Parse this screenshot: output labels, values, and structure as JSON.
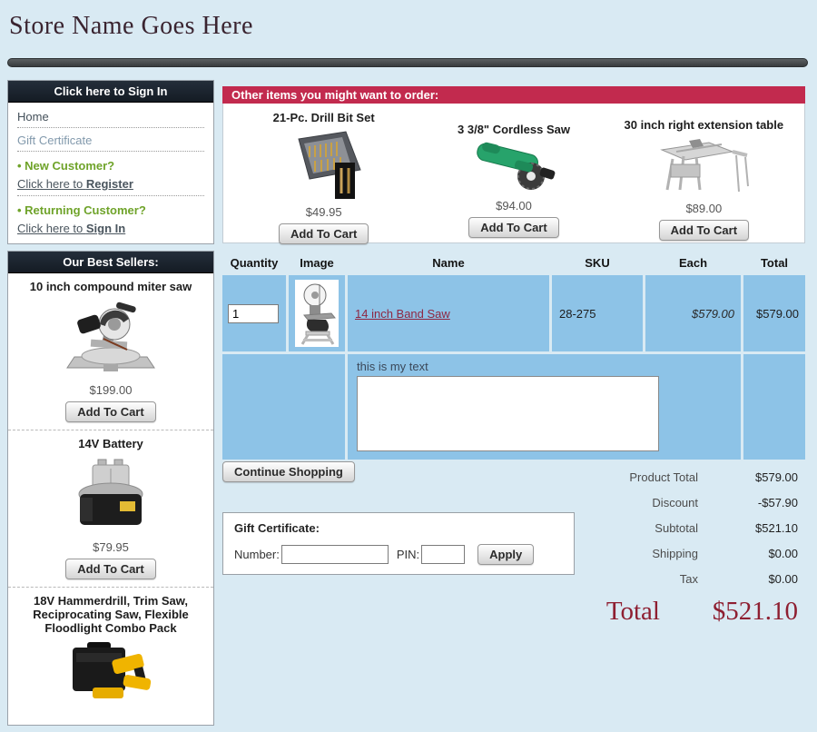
{
  "header": {
    "title": "Store Name Goes Here"
  },
  "sidebar": {
    "signin_box": {
      "header": "Click here to Sign In",
      "links": [
        {
          "label": "Home"
        },
        {
          "label": "Gift Certificate"
        }
      ],
      "new_customer": {
        "prompt": "• New Customer?",
        "link_prefix": "Click here to ",
        "link_bold": "Register"
      },
      "returning_customer": {
        "prompt": "• Returning Customer?",
        "link_prefix": "Click here to ",
        "link_bold": "Sign In"
      }
    },
    "best_sellers": {
      "header": "Our Best Sellers:",
      "products": [
        {
          "name": "10 inch compound miter saw",
          "price": "$199.00",
          "button": "Add To Cart",
          "image": "miter-saw"
        },
        {
          "name": "14V Battery",
          "price": "$79.95",
          "button": "Add To Cart",
          "image": "14v-battery"
        },
        {
          "name": "18V Hammerdrill, Trim Saw, Reciprocating Saw, Flexible Floodlight Combo Pack",
          "image": "combo-kit"
        }
      ]
    }
  },
  "upsell": {
    "header": "Other items you might want to order:",
    "products": [
      {
        "name": "21-Pc. Drill Bit Set",
        "price": "$49.95",
        "button": "Add To Cart",
        "image": "drill-bit-set"
      },
      {
        "name": "3 3/8\" Cordless Saw",
        "price": "$94.00",
        "button": "Add To Cart",
        "image": "cordless-saw"
      },
      {
        "name": "30 inch right extension table",
        "price": "$89.00",
        "button": "Add To Cart",
        "image": "extension-table"
      }
    ]
  },
  "cart": {
    "columns": {
      "quantity": "Quantity",
      "image": "Image",
      "name": "Name",
      "sku": "SKU",
      "each": "Each",
      "total": "Total"
    },
    "items": [
      {
        "quantity": "1",
        "name": "14 inch Band Saw",
        "sku": "28-275",
        "each": "$579.00",
        "total": "$579.00",
        "image": "band-saw"
      }
    ],
    "note_label": "this is my text",
    "note_value": ""
  },
  "actions": {
    "continue_shopping": "Continue Shopping"
  },
  "gift_certificate": {
    "title": "Gift Certificate:",
    "number_label": "Number:",
    "number_value": "",
    "pin_label": "PIN:",
    "pin_value": "",
    "apply_button": "Apply"
  },
  "totals": {
    "rows": [
      {
        "label": "Product Total",
        "value": "$579.00"
      },
      {
        "label": "Discount",
        "value": "-$57.90"
      },
      {
        "label": "Subtotal",
        "value": "$521.10"
      },
      {
        "label": "Shipping",
        "value": "$0.00"
      },
      {
        "label": "Tax",
        "value": "$0.00"
      }
    ],
    "total_label": "Total",
    "total_value": "$521.10"
  },
  "colors": {
    "page_background": "#d9eaf3",
    "accent_crimson": "#c22a4e",
    "table_cell_blue": "#8dc3e7",
    "maroon_link": "#8e2742",
    "grand_total_maroon": "#8e1f31",
    "green_prompt": "#6fa32a",
    "dark_header": "#141b24"
  }
}
